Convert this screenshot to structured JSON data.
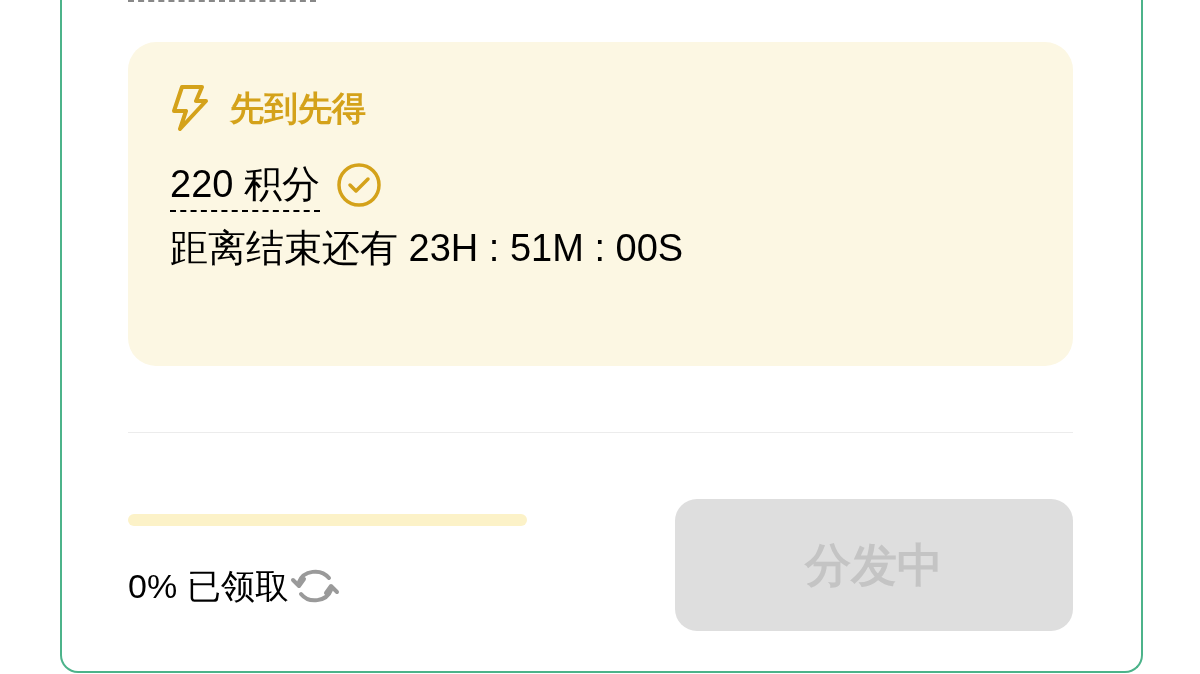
{
  "offer": {
    "title": "先到先得",
    "points": "220 积分",
    "verified": true,
    "countdown": "距离结束还有 23H : 51M : 00S"
  },
  "progress": {
    "level": 0,
    "label": "0% 已领取"
  },
  "action_button": {
    "label": "分发中",
    "disabled": true
  }
}
